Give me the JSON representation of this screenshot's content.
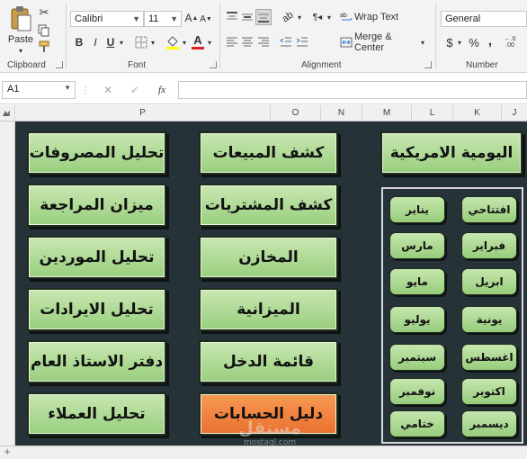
{
  "ribbon": {
    "clipboard": {
      "paste_label": "Paste",
      "group_label": "Clipboard"
    },
    "font": {
      "font_name": "Calibri",
      "font_size": "11",
      "bold": "B",
      "italic": "I",
      "underline": "U",
      "font_color_letter": "A",
      "group_label": "Font"
    },
    "alignment": {
      "wrap_text": "Wrap Text",
      "merge_center": "Merge & Center",
      "group_label": "Alignment"
    },
    "number": {
      "format": "General",
      "currency": "$",
      "percent": "%",
      "comma": ",",
      "group_label": "Number"
    }
  },
  "formula_bar": {
    "name_box": "A1",
    "fx": "fx",
    "cancel": "✕",
    "enter": "✓"
  },
  "columns": [
    "P",
    "O",
    "N",
    "M",
    "L",
    "K",
    "J"
  ],
  "buttons": {
    "left": [
      "تحليل المصروفات",
      "ميزان المراجعة",
      "تحليل الموردين",
      "تحليل الايرادات",
      "دفتر الاستاذ العام",
      "تحليل العملاء"
    ],
    "middle": [
      "كشف المبيعات",
      "كشف المشتريات",
      "المخازن",
      "الميزانية",
      "قائمة الدخل",
      "دليل الحسابات"
    ],
    "daily": "اليومية الامريكية"
  },
  "months": {
    "left_col": [
      "يناير",
      "مارس",
      "مايو",
      "يوليو",
      "سبتمبر",
      "نوفمبر",
      "ختامي"
    ],
    "right_col": [
      "افتتاحي",
      "فبراير",
      "ابريل",
      "يونية",
      "اغسطس",
      "اكتوبر",
      "ديسمبر"
    ]
  },
  "watermark": {
    "arabic": "مستقل",
    "latin": "mostaql.com"
  },
  "colors": {
    "sheet_bg": "#253238",
    "button_green": "#a9d88d",
    "button_orange": "#f08a42"
  }
}
